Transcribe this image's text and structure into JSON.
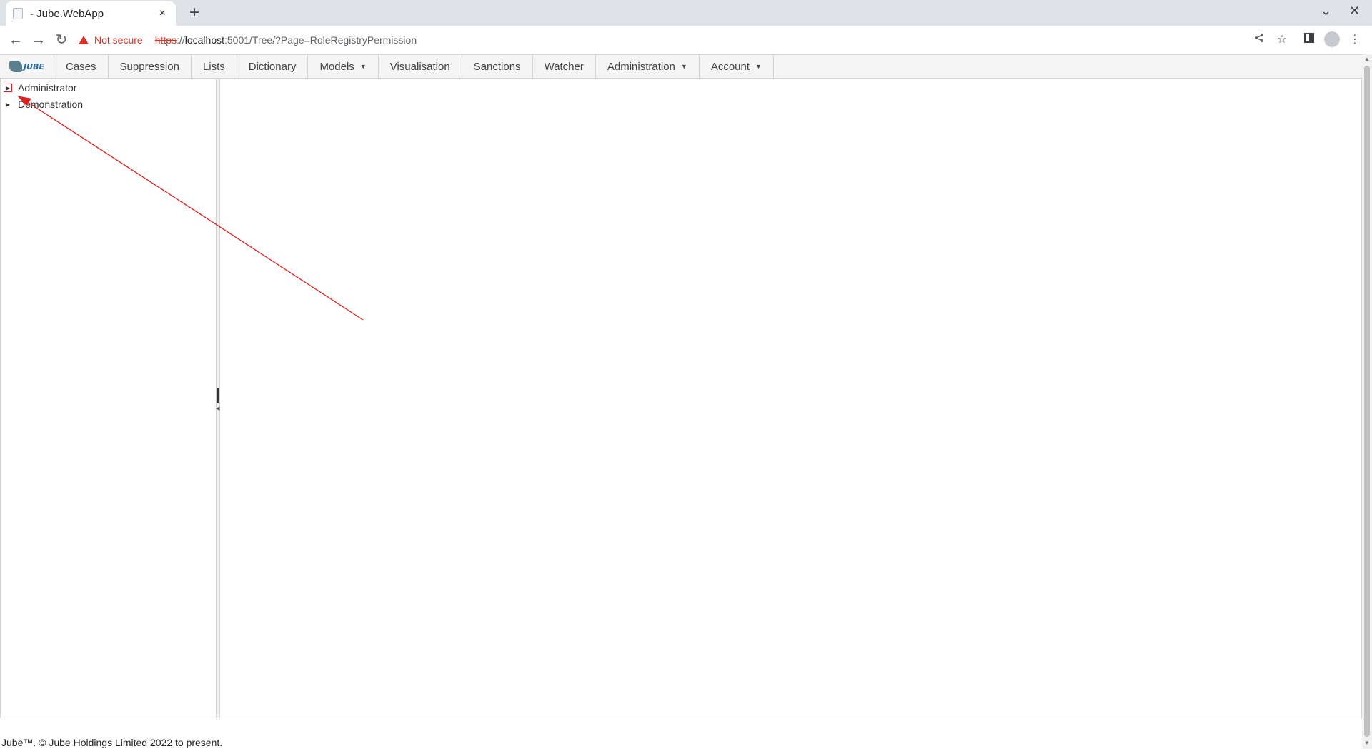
{
  "browser": {
    "tab_title": "- Jube.WebApp",
    "tab_close": "×",
    "new_tab": "+",
    "window_controls": {
      "minimize_chevron": "⌄",
      "close": "✕"
    },
    "nav": {
      "back": "←",
      "forward": "→",
      "reload": "↻"
    },
    "security_label": "Not secure",
    "url": {
      "scheme": "https",
      "separator": "://",
      "host": "localhost",
      "rest": ":5001/Tree/?Page=RoleRegistryPermission"
    },
    "icons": [
      "share-icon",
      "star-icon",
      "side-panel-icon",
      "profile-icon",
      "menu-icon"
    ]
  },
  "app": {
    "logo_text": "JUBE",
    "menu": [
      {
        "label": "Cases",
        "dropdown": false
      },
      {
        "label": "Suppression",
        "dropdown": false
      },
      {
        "label": "Lists",
        "dropdown": false
      },
      {
        "label": "Dictionary",
        "dropdown": false
      },
      {
        "label": "Models",
        "dropdown": true
      },
      {
        "label": "Visualisation",
        "dropdown": false
      },
      {
        "label": "Sanctions",
        "dropdown": false
      },
      {
        "label": "Watcher",
        "dropdown": false
      },
      {
        "label": "Administration",
        "dropdown": true
      },
      {
        "label": "Account",
        "dropdown": true
      }
    ],
    "tree": [
      {
        "label": "Administrator",
        "expanded": false,
        "highlighted": true
      },
      {
        "label": "Demonstration",
        "expanded": false,
        "highlighted": false
      }
    ],
    "footer": "Jube™. © Jube Holdings Limited 2022 to present."
  },
  "annotation": {
    "color": "#e0201f"
  }
}
